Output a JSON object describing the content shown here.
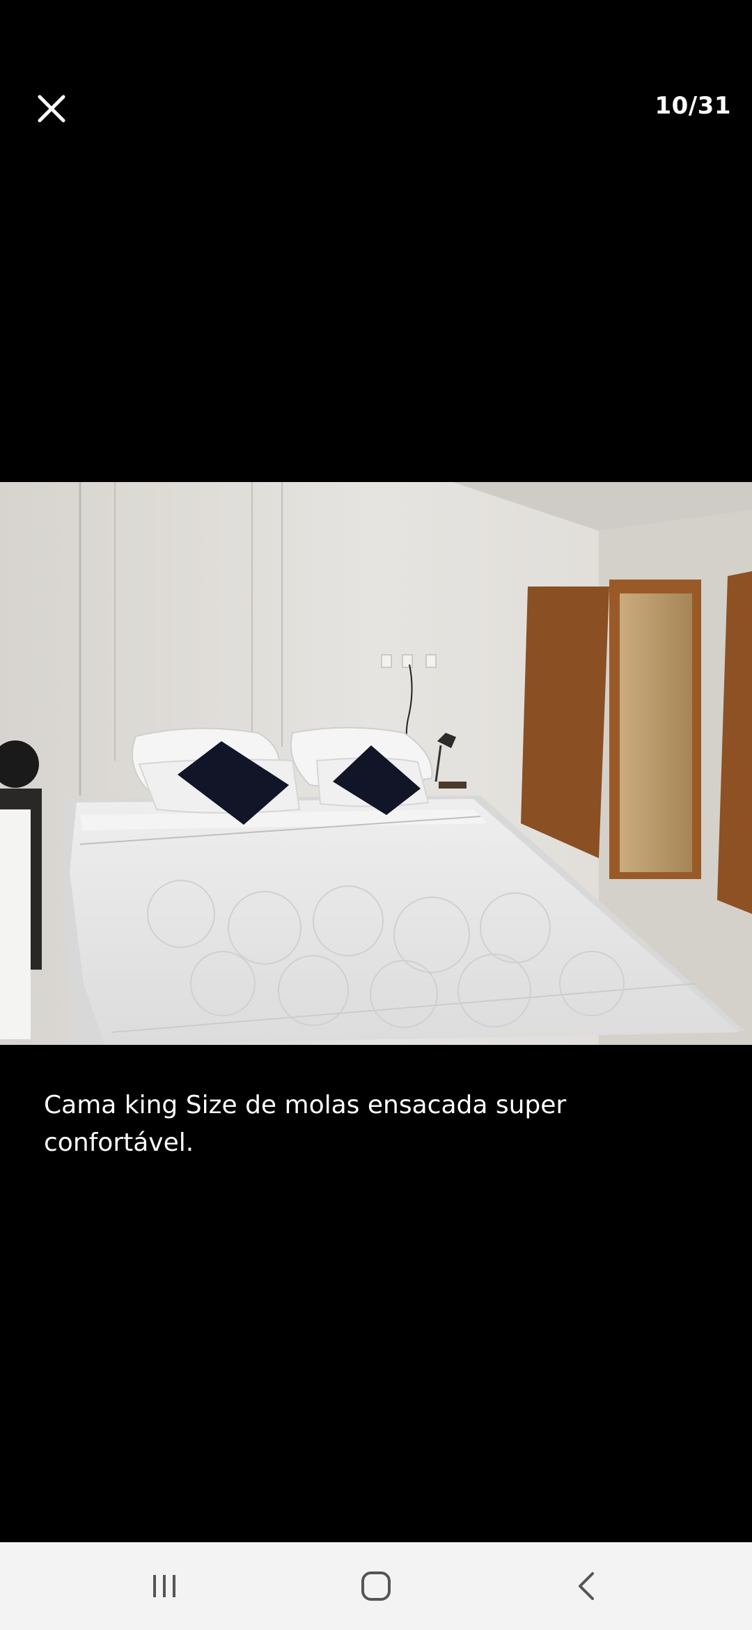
{
  "header": {
    "close_icon": "close-icon",
    "counter": "10/31"
  },
  "photo": {
    "alt": "Cama king Size de molas ensacada super confortável."
  },
  "caption": {
    "text": "Cama king Size de molas ensacada super confortável."
  },
  "navbar": {
    "recents_icon": "recents-icon",
    "home_icon": "home-icon",
    "back_icon": "back-icon"
  },
  "colors": {
    "background": "#000000",
    "text": "#ffffff",
    "navbar_bg": "#f3f3f3",
    "navbar_icon": "#555555"
  }
}
